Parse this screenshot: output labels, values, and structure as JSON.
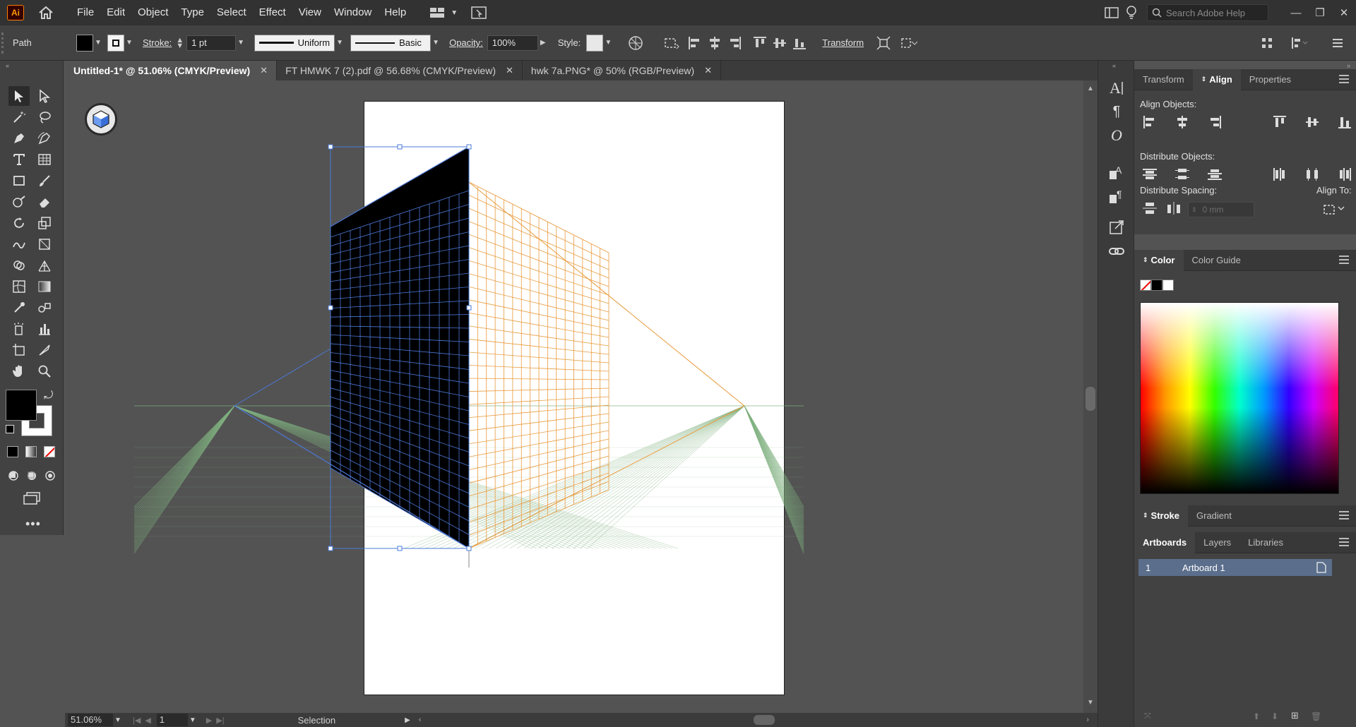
{
  "app": {
    "logo": "Ai"
  },
  "menu": [
    "File",
    "Edit",
    "Object",
    "Type",
    "Select",
    "Effect",
    "View",
    "Window",
    "Help"
  ],
  "search": {
    "placeholder": "Search Adobe Help"
  },
  "control": {
    "selection_type": "Path",
    "stroke_label": "Stroke:",
    "stroke_weight": "1 pt",
    "profile_label": "Uniform",
    "brush_label": "Basic",
    "opacity_label": "Opacity:",
    "opacity_value": "100%",
    "style_label": "Style:",
    "transform_label": "Transform"
  },
  "tabs": [
    {
      "label": "Untitled-1* @ 51.06% (CMYK/Preview)",
      "active": true
    },
    {
      "label": "FT HMWK 7 (2).pdf @ 56.68% (CMYK/Preview)",
      "active": false
    },
    {
      "label": "hwk 7a.PNG* @ 50% (RGB/Preview)",
      "active": false
    }
  ],
  "status": {
    "zoom": "51.06%",
    "artboard_num": "1",
    "tool": "Selection"
  },
  "panels": {
    "transform_tabs": [
      "Transform",
      "Align",
      "Properties"
    ],
    "align_objects": "Align Objects:",
    "distribute_objects": "Distribute Objects:",
    "distribute_spacing": "Distribute Spacing:",
    "align_to": "Align To:",
    "spacing_value": "0 mm",
    "color_tabs": [
      "Color",
      "Color Guide"
    ],
    "stroke_tabs": [
      "Stroke",
      "Gradient"
    ],
    "artboard_tabs": [
      "Artboards",
      "Layers",
      "Libraries"
    ],
    "artboard_row": {
      "num": "1",
      "name": "Artboard 1"
    }
  },
  "colors": {
    "fill": "#000000",
    "stroke": "#ffffff",
    "left_grid": "#4c78d8",
    "right_grid": "#e89a3c",
    "ground_grid": "#7fb07f"
  }
}
